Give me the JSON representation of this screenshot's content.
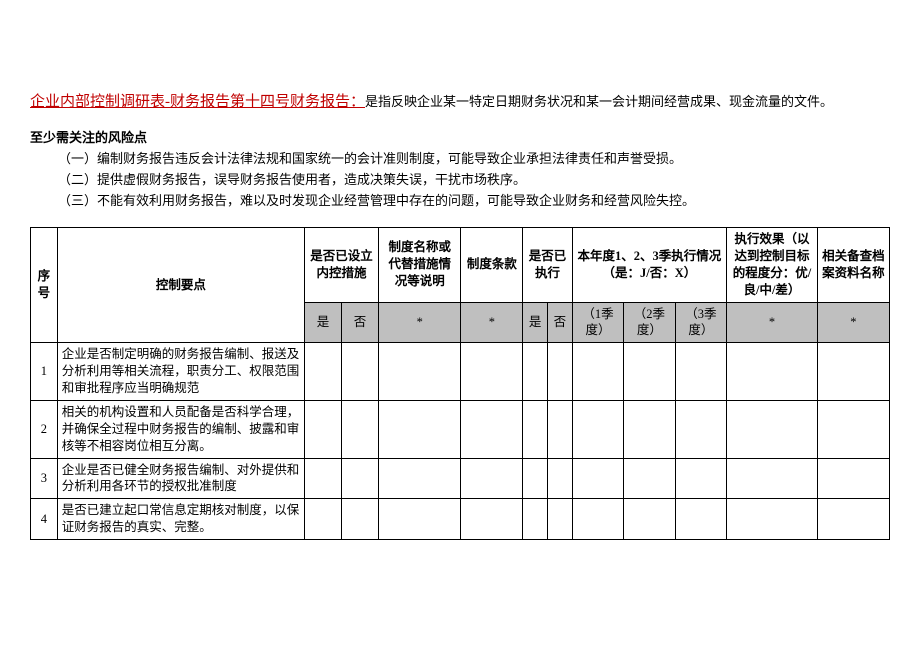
{
  "title": {
    "main": "企业内部控制调研表-财务报告第十四号财务报告：",
    "desc": "是指反映企业某一特定日期财务状况和某一会计期间经营成果、现金流量的文件。"
  },
  "risk": {
    "heading": "至少需关注的风险点",
    "items": [
      "（一）编制财务报告违反会计法律法规和国家统一的会计准则制度，可能导致企业承担法律责任和声誉受损。",
      "（二）提供虚假财务报告，误导财务报告使用者，造成决策失误，干扰市场秩序。",
      "（三）不能有效利用财务报告，难以及时发现企业经营管理中存在的问题，可能导致企业财务和经营风险失控。"
    ]
  },
  "table": {
    "headers": {
      "idx": "序号",
      "point": "控制要点",
      "internal": "是否已设立内控措施",
      "system": "制度名称或代替措施情况等说明",
      "clause": "制度条款",
      "executed": "是否已执行",
      "quarters": "本年度1、2、3季执行情况（是：J/否：X）",
      "effect": "执行效果（以达到控制目标的程度分：优/良/中/差）",
      "docs": "相关备查档案资料名称"
    },
    "sub": {
      "yes": "是",
      "no": "否",
      "star": "*",
      "eyes": "是",
      "eno": "否",
      "q1": "（1季度）",
      "q2": "（2季度）",
      "q3": "（3季度）"
    },
    "rows": [
      {
        "idx": "1",
        "point": "企业是否制定明确的财务报告编制、报送及分析利用等相关流程，职责分工、权限范围和审批程序应当明确规范"
      },
      {
        "idx": "2",
        "point": "相关的机构设置和人员配备是否科学合理，并确保全过程中财务报告的编制、披露和审核等不相容岗位相互分离。"
      },
      {
        "idx": "3",
        "point": "企业是否已健全财务报告编制、对外提供和分析利用各环节的授权批准制度"
      },
      {
        "idx": "4",
        "point": "是否已建立起口常信息定期核对制度，以保证财务报告的真实、完整。"
      }
    ]
  }
}
